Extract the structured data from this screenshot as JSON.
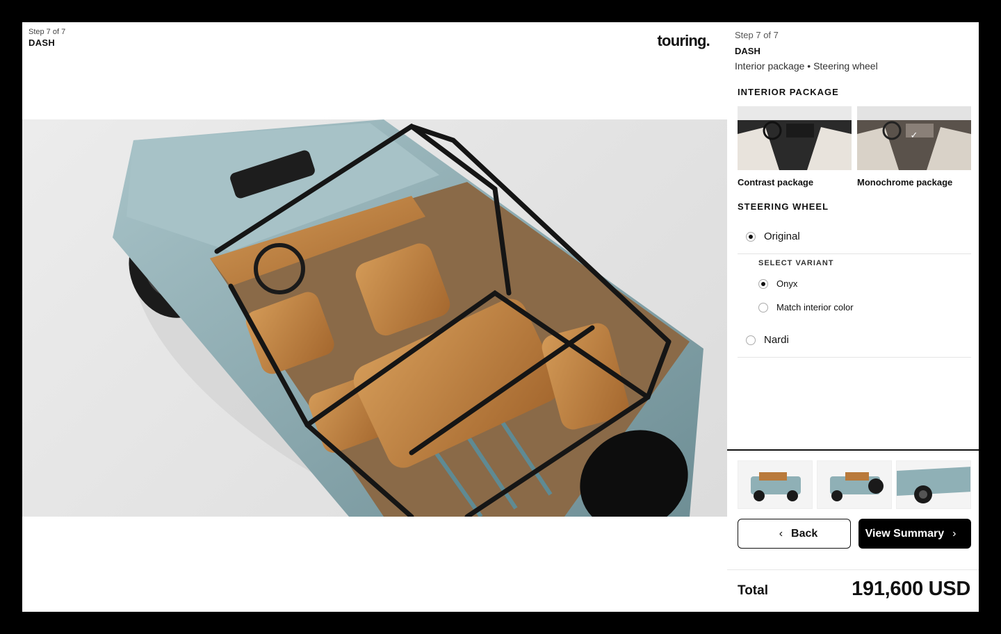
{
  "stage": {
    "step": "Step 7 of 7",
    "title": "DASH",
    "brand": "touring."
  },
  "panel": {
    "step": "Step 7 of 7",
    "title": "DASH",
    "subtitle": "Interior package • Steering wheel",
    "interior_package": {
      "label": "INTERIOR PACKAGE",
      "options": [
        {
          "label": "Contrast package",
          "selected": false
        },
        {
          "label": "Monochrome package",
          "selected": true
        }
      ]
    },
    "steering_wheel": {
      "label": "STEERING WHEEL",
      "options": [
        {
          "label": "Original",
          "selected": true
        },
        {
          "label": "Nardi",
          "selected": false
        }
      ],
      "variant_label": "SELECT VARIANT",
      "variants": [
        {
          "label": "Onyx",
          "selected": true
        },
        {
          "label": "Match interior color",
          "selected": false
        }
      ]
    },
    "buttons": {
      "back": "Back",
      "summary": "View Summary"
    },
    "total": {
      "label": "Total",
      "value": "191,600 USD"
    }
  },
  "colors": {
    "body_teal": "#8fb0b6",
    "interior_tan": "#b97a3b",
    "accent_black": "#000000"
  },
  "icons": {
    "back": "chevron-left-icon",
    "summary": "chevron-right-icon",
    "selected": "checkmark-icon"
  }
}
